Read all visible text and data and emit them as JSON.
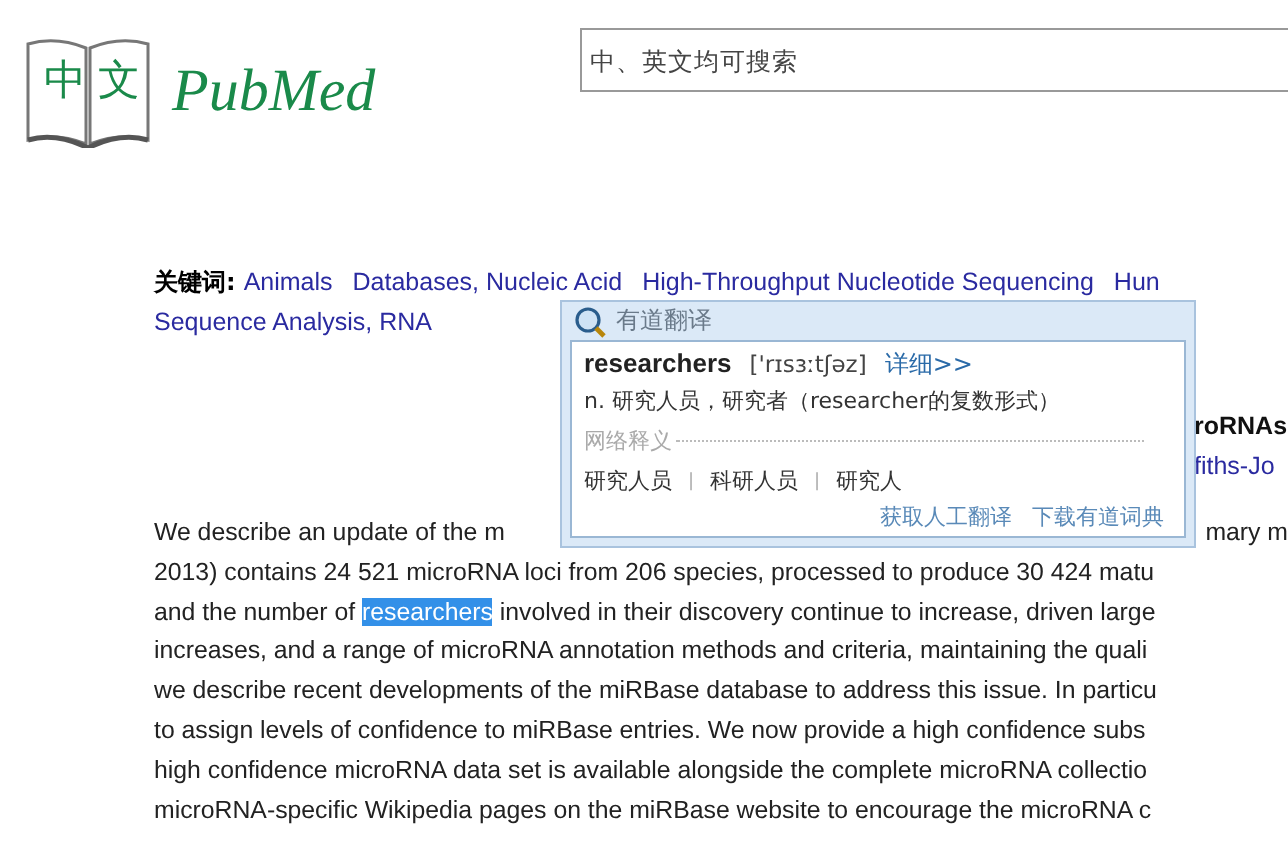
{
  "logo": {
    "chinese": "中文",
    "name": "PubMed"
  },
  "search": {
    "placeholder": "中、英文均可搜索"
  },
  "keywords": {
    "label": "关键词:",
    "items": [
      "Animals",
      "Databases, Nucleic Acid",
      "High-Throughput Nucleotide Sequencing",
      "Hun",
      "Sequence Analysis, RNA"
    ]
  },
  "title_fragment": "roRNAs",
  "author_fragment": "fiths-Jo",
  "abstract": {
    "first_line": {
      "left": "We describe an update of the m",
      "right": "mary m"
    },
    "lines": [
      {
        "before": "2013) contains 24 521 microRNA loci from 206 species, processed to produce 30 424 matu"
      },
      {
        "before": "and the number of ",
        "selected": "researchers",
        "after": " involved in their discovery continue to increase, driven large"
      },
      {
        "before": "increases, and a range of microRNA annotation methods and criteria, maintaining the quali"
      },
      {
        "before": "we describe recent developments of the miRBase database to address this issue. In particu"
      },
      {
        "before": "to assign levels of confidence to miRBase entries. We now provide a high confidence subs"
      },
      {
        "before": "high confidence microRNA data set is available alongside the complete microRNA collectio"
      },
      {
        "before": "microRNA-specific Wikipedia pages on the miRBase website to encourage the microRNA c"
      }
    ]
  },
  "popup": {
    "title": "有道翻译",
    "word": "researchers",
    "phonetic": "['rɪsɜːtʃəz]",
    "detail_link": "详细>>",
    "definition": "n. 研究人员，研究者（researcher的复数形式）",
    "web_label": "网络释义",
    "web_meanings": [
      "研究人员",
      "科研人员",
      "研究人"
    ],
    "separator": "|",
    "links": [
      "获取人工翻译",
      "下载有道词典"
    ]
  }
}
